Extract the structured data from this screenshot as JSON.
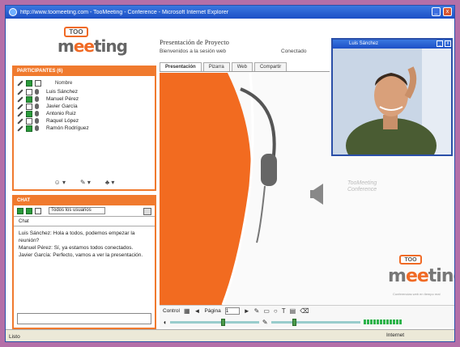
{
  "window": {
    "title": "http://www.toomeeting.com - TooMeeting - Conference - Microsoft Internet Explorer",
    "min_label": "_",
    "close_label": "x"
  },
  "logo": {
    "tag": "TOO",
    "word_a": "m",
    "word_highlight": "ee",
    "word_b": "ting"
  },
  "users_panel": {
    "header": "PARTICIPANTES (6)",
    "toolbar_label": "Nombre",
    "users": [
      {
        "name": "Luis Sánchez"
      },
      {
        "name": "Manuel Pérez"
      },
      {
        "name": "Javier García"
      },
      {
        "name": "Antonio Ruiz"
      },
      {
        "name": "Raquel López"
      },
      {
        "name": "Ramón Rodríguez"
      }
    ],
    "bottom_icons": [
      "☺ ▾",
      "✎ ▾",
      "♣ ▾"
    ]
  },
  "chat_panel": {
    "header": "CHAT",
    "to_value": "Todos los usuarios",
    "tab_label": "Chat",
    "messages": [
      "Luis Sánchez: Hola a todos, podemos empezar la reunión?",
      "Manuel Pérez: Sí, ya estamos todos conectados.",
      "Javier García: Perfecto, vamos a ver la presentación."
    ]
  },
  "conference": {
    "title": "Presentación de Proyecto",
    "subtitle": "Bienvenidos a la sesión web",
    "subtitle2": "Conectado",
    "tabs": [
      "Presentación",
      "Pizarra",
      "Web",
      "Compartir"
    ],
    "active_tab": 0
  },
  "stage": {
    "caption_line1": "TooMeeting",
    "caption_line2": "Conference",
    "slogan": "Conferencias web en tiempo real"
  },
  "video": {
    "title": "Luis Sánchez",
    "min": "_",
    "close": "x"
  },
  "toolbar": {
    "scroll_label": "Control",
    "page_label": "Página",
    "page_value": "1",
    "icons": [
      "◄",
      "►",
      "✎",
      "▭",
      "○",
      "T",
      "▤",
      "⌫"
    ]
  },
  "media": {
    "volume": 0.6,
    "mic": 0.25,
    "level_bars": 12
  },
  "status": {
    "left": "Listo",
    "zone": "Internet"
  },
  "colors": {
    "accent": "#f06a25",
    "frame": "#2a4fa8"
  }
}
